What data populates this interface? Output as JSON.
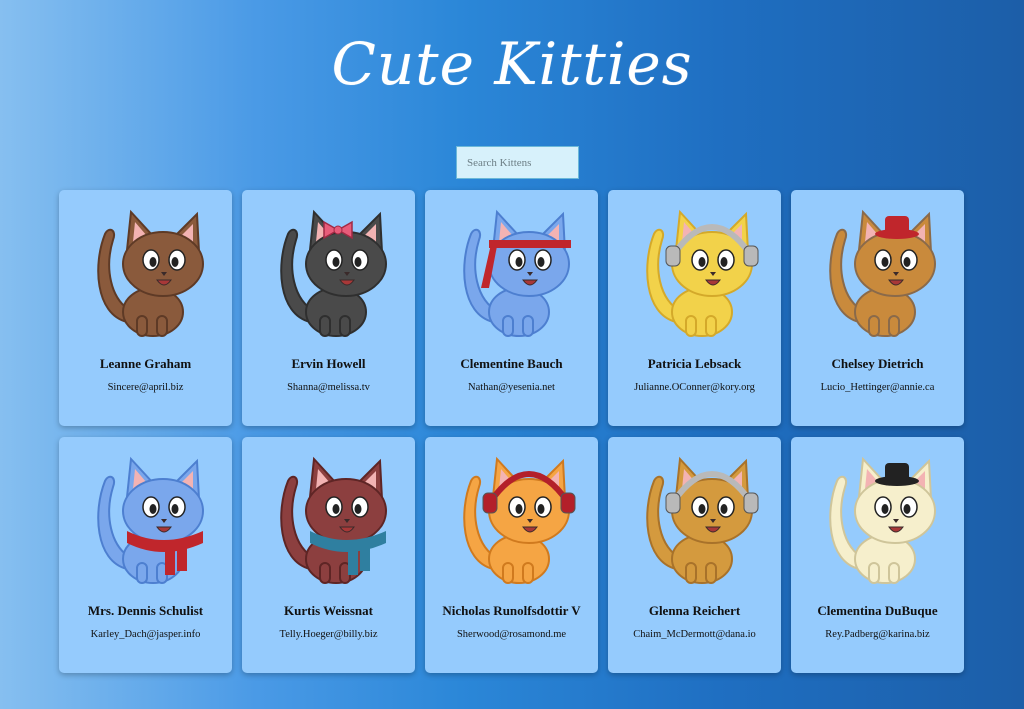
{
  "header": {
    "title": "Cute Kitties"
  },
  "search": {
    "placeholder": "Search Kittens"
  },
  "cards": [
    {
      "name": "Leanne Graham",
      "email": "Sincere@april.biz",
      "fur": "#8a5a3c",
      "dark": "#5e3a26",
      "accessory": "none"
    },
    {
      "name": "Ervin Howell",
      "email": "Shanna@melissa.tv",
      "fur": "#4a4a4a",
      "dark": "#2f2f2f",
      "accessory": "bow"
    },
    {
      "name": "Clementine Bauch",
      "email": "Nathan@yesenia.net",
      "fur": "#7aa7ec",
      "dark": "#4d7fd0",
      "accessory": "headband"
    },
    {
      "name": "Patricia Lebsack",
      "email": "Julianne.OConner@kory.org",
      "fur": "#f2d24a",
      "dark": "#d4a92a",
      "accessory": "headphones-silver"
    },
    {
      "name": "Chelsey Dietrich",
      "email": "Lucio_Hettinger@annie.ca",
      "fur": "#c98a3c",
      "dark": "#8a6a4a",
      "accessory": "red-hat"
    },
    {
      "name": "Mrs. Dennis Schulist",
      "email": "Karley_Dach@jasper.info",
      "fur": "#7aa7ec",
      "dark": "#4d7fd0",
      "accessory": "red-scarf"
    },
    {
      "name": "Kurtis Weissnat",
      "email": "Telly.Hoeger@billy.biz",
      "fur": "#8c3f3f",
      "dark": "#5e2525",
      "accessory": "blue-scarf"
    },
    {
      "name": "Nicholas Runolfsdottir V",
      "email": "Sherwood@rosamond.me",
      "fur": "#f5a544",
      "dark": "#d07a1e",
      "accessory": "headphones-red"
    },
    {
      "name": "Glenna Reichert",
      "email": "Chaim_McDermott@dana.io",
      "fur": "#d49a3e",
      "dark": "#a8722a",
      "accessory": "headphones-silver"
    },
    {
      "name": "Clementina DuBuque",
      "email": "Rey.Padberg@karina.biz",
      "fur": "#f6efcc",
      "dark": "#cfc59a",
      "accessory": "black-hat"
    }
  ]
}
